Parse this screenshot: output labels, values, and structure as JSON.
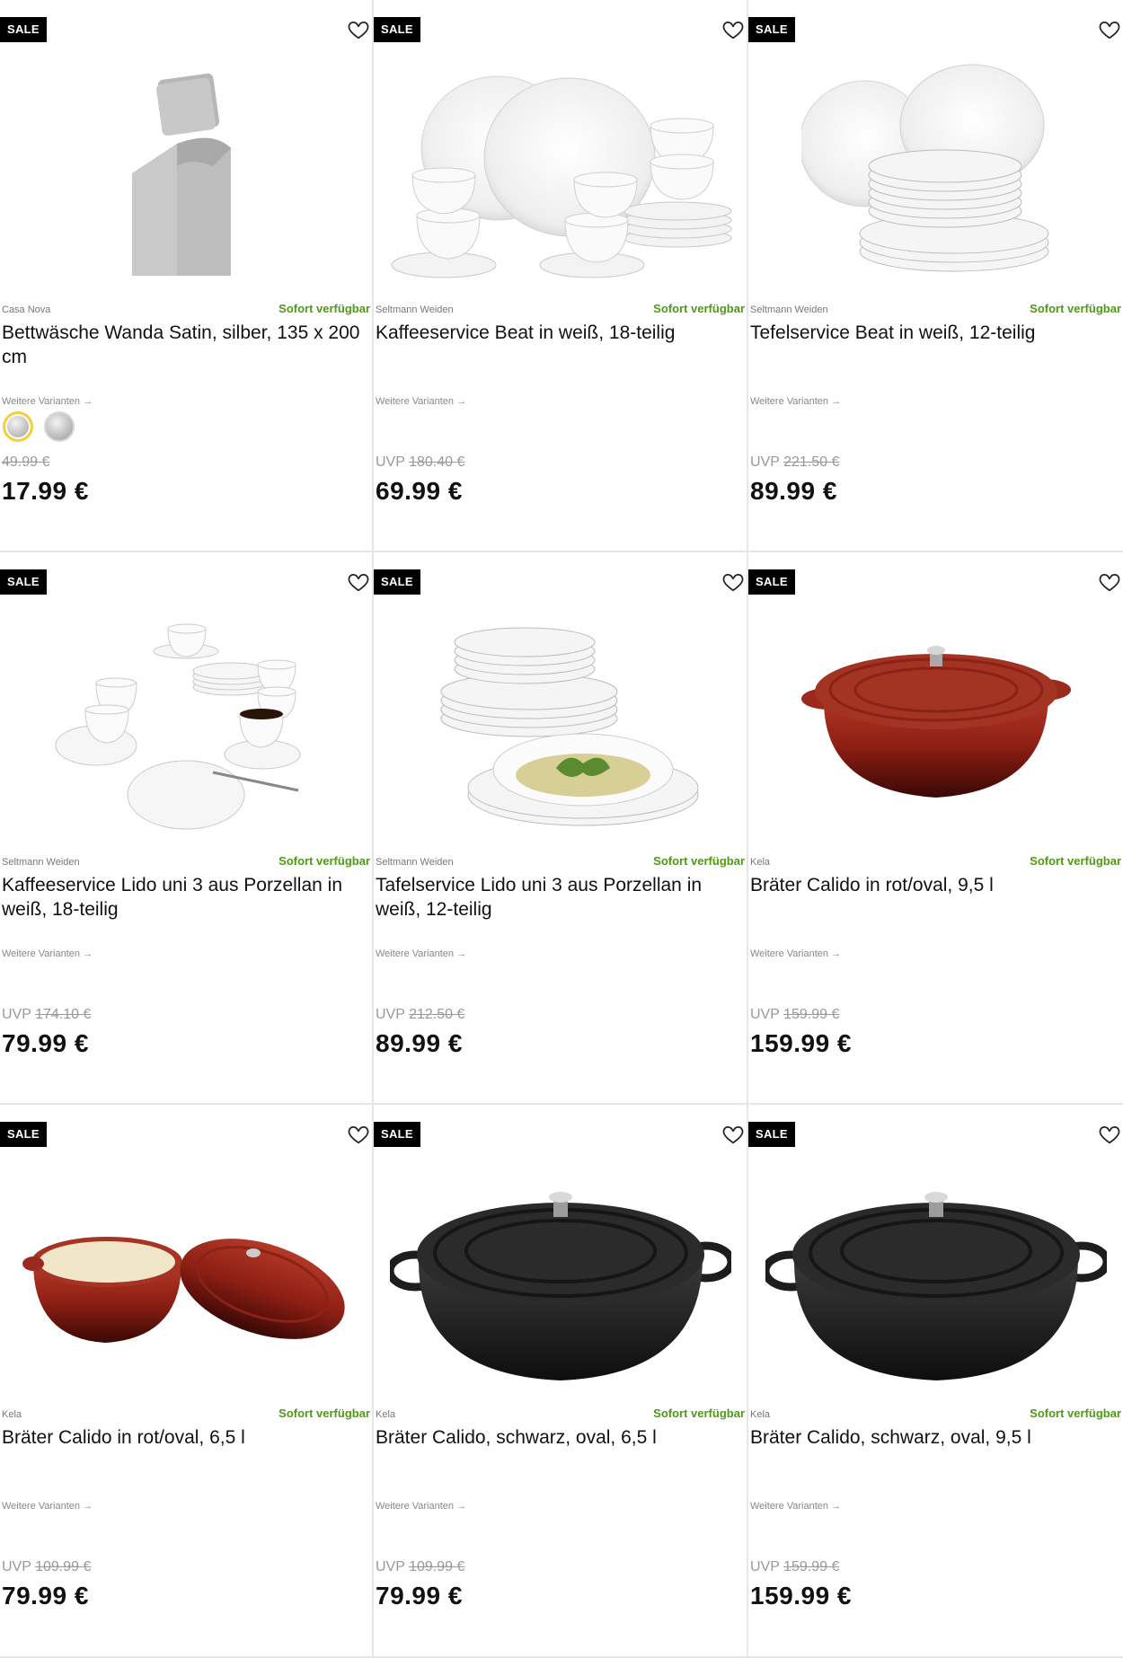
{
  "products": [
    {
      "badge": "SALE",
      "brand": "Casa Nova",
      "availability": "Sofort verfügbar",
      "title": "Bettwäsche Wanda Satin, silber, 135 x 200 cm",
      "variants_link": "Weitere Varianten →",
      "uvp_label": "",
      "old_price": "49.99 €",
      "price": "17.99 €",
      "image": "bedding-image",
      "swatches": [
        "silver-light",
        "silver"
      ]
    },
    {
      "badge": "SALE",
      "brand": "Seltmann Weiden",
      "availability": "Sofort verfügbar",
      "title": "Kaffeeservice Beat in weiß, 18-teilig",
      "variants_link": "Weitere Varianten →",
      "uvp_label": "UVP",
      "old_price": "180.40 €",
      "price": "69.99 €",
      "image": "coffee-set-image"
    },
    {
      "badge": "SALE",
      "brand": "Seltmann Weiden",
      "availability": "Sofort verfügbar",
      "title": "Tefelservice Beat in weiß, 12-teilig",
      "variants_link": "Weitere Varianten →",
      "uvp_label": "UVP",
      "old_price": "221.50 €",
      "price": "89.99 €",
      "image": "plate-stack-image"
    },
    {
      "badge": "SALE",
      "brand": "Seltmann Weiden",
      "availability": "Sofort verfügbar",
      "title": "Kaffeeservice Lido uni 3 aus Porzellan in weiß, 18-teilig",
      "variants_link": "Weitere Varianten →",
      "uvp_label": "UVP",
      "old_price": "174.10 €",
      "price": "79.99 €",
      "image": "coffee-set-image"
    },
    {
      "badge": "SALE",
      "brand": "Seltmann Weiden",
      "availability": "Sofort verfügbar",
      "title": "Tafelservice Lido uni 3 aus Porzellan in weiß, 12-teilig",
      "variants_link": "Weitere Varianten →",
      "uvp_label": "UVP",
      "old_price": "212.50 €",
      "price": "89.99 €",
      "image": "dinner-set-image"
    },
    {
      "badge": "SALE",
      "brand": "Kela",
      "availability": "Sofort verfügbar",
      "title": "Bräter Calido in rot/oval, 9,5 l",
      "variants_link": "Weitere Varianten →",
      "uvp_label": "UVP",
      "old_price": "159.99 €",
      "price": "159.99 €",
      "image": "red-roaster-image"
    },
    {
      "badge": "SALE",
      "brand": "Kela",
      "availability": "Sofort verfügbar",
      "title": "Bräter Calido in rot/oval, 6,5 l",
      "variants_link": "Weitere Varianten →",
      "uvp_label": "UVP",
      "old_price": "109.99 €",
      "price": "79.99 €",
      "image": "red-roaster-open-image"
    },
    {
      "badge": "SALE",
      "brand": "Kela",
      "availability": "Sofort verfügbar",
      "title": "Bräter Calido, schwarz, oval, 6,5 l",
      "variants_link": "Weitere Varianten →",
      "uvp_label": "UVP",
      "old_price": "109.99 €",
      "price": "79.99 €",
      "image": "black-roaster-image"
    },
    {
      "badge": "SALE",
      "brand": "Kela",
      "availability": "Sofort verfügbar",
      "title": "Bräter Calido, schwarz, oval, 9,5 l",
      "variants_link": "Weitere Varianten →",
      "uvp_label": "UVP",
      "old_price": "159.99 €",
      "price": "159.99 €",
      "image": "black-roaster-image"
    }
  ],
  "colors": {
    "sale_bg": "#000000",
    "availability": "#4e9b12",
    "old_price": "#999999",
    "swatch_selected": "#f2d13b"
  },
  "icons": {
    "wishlist": "heart-outline-icon"
  }
}
